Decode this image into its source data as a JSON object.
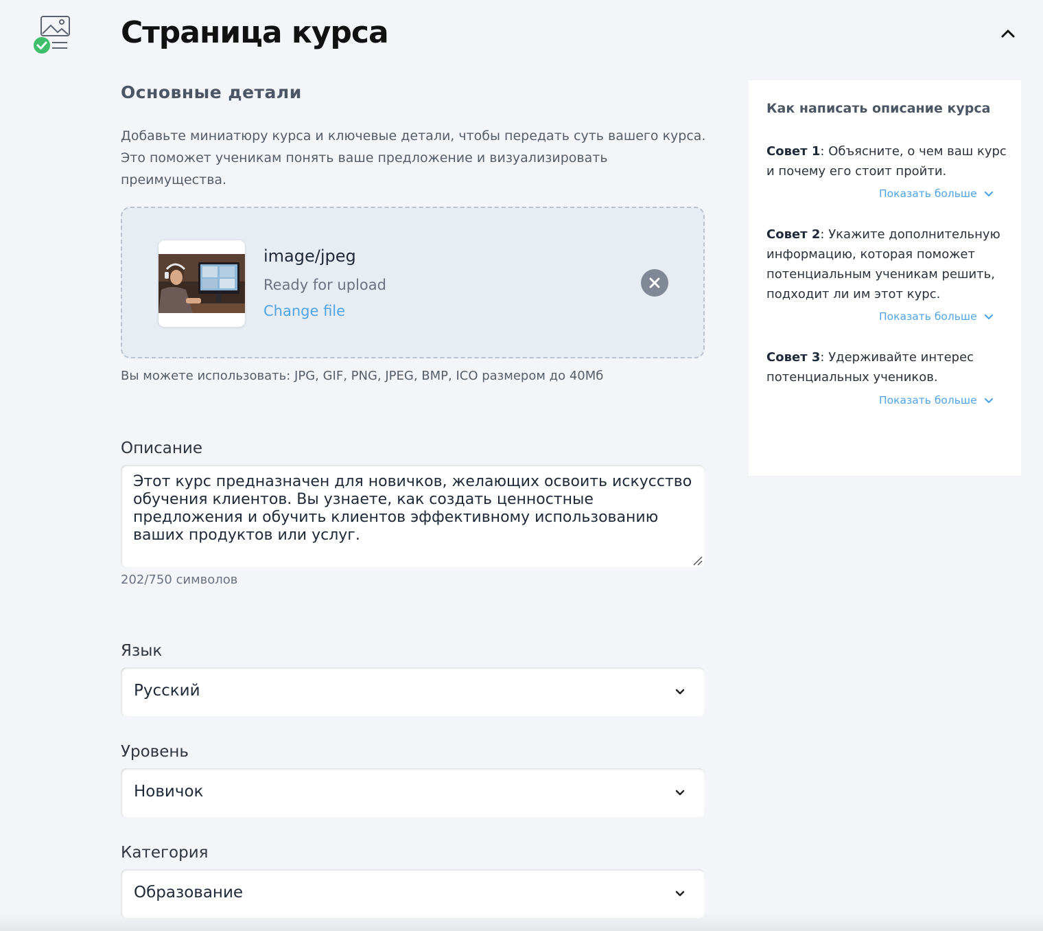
{
  "header": {
    "title": "Страница курса"
  },
  "basic": {
    "heading": "Основные детали",
    "intro": "Добавьте миниатюру курса и ключевые детали, чтобы передать суть вашего курса. Это поможет ученикам понять ваше предложение и визуализировать преимущества."
  },
  "upload": {
    "file_type": "image/jpeg",
    "status": "Ready for upload",
    "change_label": "Change file",
    "formats_note": "Вы можете использовать: JPG, GIF, PNG, JPEG, BMP, ICO размером до 40Мб"
  },
  "description": {
    "label": "Описание",
    "value": "Этот курс предназначен для новичков, желающих освоить искусство обучения клиентов. Вы узнаете, как создать ценностные предложения и обучить клиентов эффективному использованию ваших продуктов или услуг.",
    "char_count": "202/750 символов"
  },
  "language": {
    "label": "Язык",
    "value": "Русский"
  },
  "level": {
    "label": "Уровень",
    "value": "Новичок"
  },
  "category": {
    "label": "Категория",
    "value": "Образование"
  },
  "tips": {
    "title": "Как написать описание курса",
    "items": [
      {
        "label": "Совет 1",
        "text": ": Объясните, о чем ваш курс и почему его стоит пройти."
      },
      {
        "label": "Совет 2",
        "text": ": Укажите дополнительную информацию, которая поможет потенциальным ученикам решить, подходит ли им этот курс."
      },
      {
        "label": "Совет 3",
        "text": ": Удерживайте интерес потенциальных учеников."
      }
    ],
    "show_more_label": "Показать больше"
  },
  "colors": {
    "accent": "#4ea4e6",
    "success": "#3fbf6a",
    "background": "#f3f5f9"
  }
}
